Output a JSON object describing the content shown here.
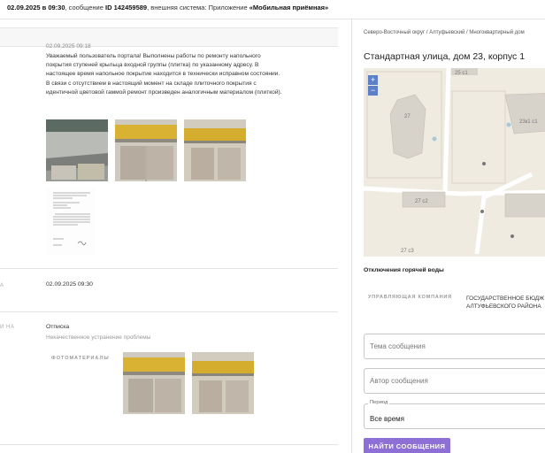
{
  "header": {
    "date_time": "02.09.2025 в 09:30",
    "text_after_date": ", сообщение ",
    "message_id": "ID 142459589",
    "system_text": ", внешняя система: Приложение ",
    "app_name": "«Мобильная приёмная»"
  },
  "message": {
    "date": "02.09.2025 09:18",
    "body": "Уважаемый пользователь портала! Выполнены работы по ремонту напольного покрытия ступеней крыльца входной группы (плитка) по указанному адресу. В настоящее время напольное покрытие находится в технически исправном состоянии. В связи с отсутствием в настоящий момент на складе плиточного покрытия с идентичной цветовой гаммой ремонт произведен аналогичным материалом (плиткой)."
  },
  "rows": {
    "row1": {
      "label_fragment": "А",
      "value": "02.09.2025 09:30"
    },
    "row2": {
      "label_fragment": "И НА",
      "value": "Отписка",
      "sub": "Некачественное устранение проблемы"
    },
    "photos_label": "ФОТОМАТЕРИАЛЫ"
  },
  "right": {
    "breadcrumb": "Северо-Восточный округ / Алтуфьевский / Многоквартирный дом",
    "address": "Стандартная улица, дом 23, корпус 1",
    "map": {
      "labels": [
        "25 с1",
        "27",
        "23к1 с1",
        "27 с2",
        "27 с3"
      ],
      "zoom_in": "+",
      "zoom_out": "−"
    },
    "problem": "Отключения горячей воды",
    "uk_label": "УПРАВЛЯЮЩАЯ КОМПАНИЯ",
    "uk_value": "ГОСУДАРСТВЕННОЕ БЮДЖ АЛТУФЬЕВСКОГО РАЙОНА",
    "fields": {
      "topic_placeholder": "Тема сообщения",
      "author_placeholder": "Автор сообщения",
      "period_legend": "Период",
      "period_value": "Все время"
    },
    "search_button": "НАЙТИ СООБЩЕНИЯ"
  },
  "colors": {
    "accent": "#8d6fd6",
    "zoom": "#5d7fc8",
    "map_bg": "#efebe1"
  }
}
